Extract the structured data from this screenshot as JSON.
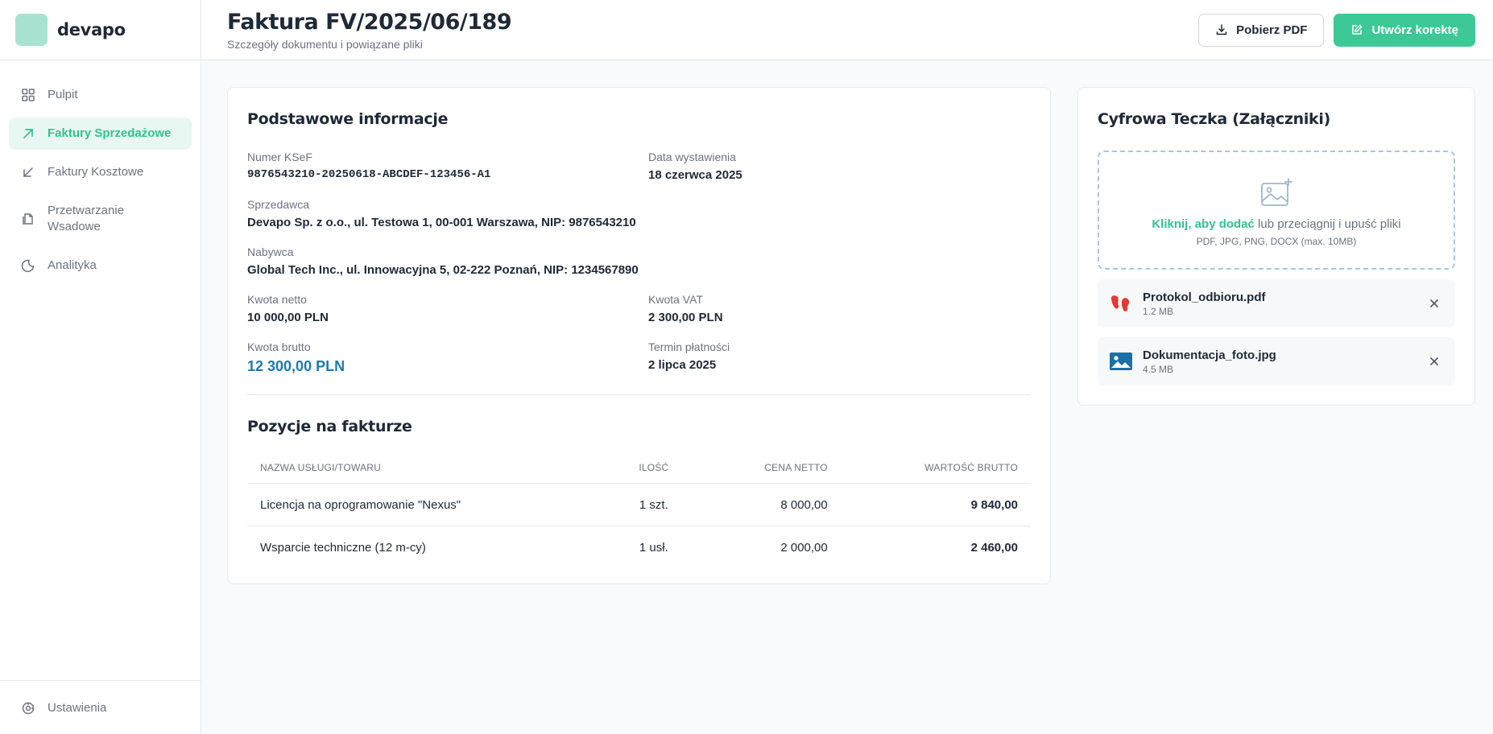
{
  "brand": {
    "name": "devapo"
  },
  "sidebar": {
    "items": [
      {
        "label": "Pulpit",
        "icon": "grid-icon"
      },
      {
        "label": "Faktury Sprzedażowe",
        "icon": "arrow-up-right-icon",
        "active": true
      },
      {
        "label": "Faktury Kosztowe",
        "icon": "arrow-down-left-icon"
      },
      {
        "label": "Przetwarzanie Wsadowe",
        "icon": "files-icon"
      },
      {
        "label": "Analityka",
        "icon": "chart-pie-icon"
      }
    ],
    "footer": {
      "label": "Ustawienia",
      "icon": "settings-icon"
    }
  },
  "header": {
    "title": "Faktura FV/2025/06/189",
    "subtitle": "Szczegóły dokumentu i powiązane pliki",
    "download_label": "Pobierz PDF",
    "correction_label": "Utwórz korektę"
  },
  "info": {
    "title": "Podstawowe informacje",
    "ksef_label": "Numer KSeF",
    "ksef_value": "9876543210-20250618-ABCDEF-123456-A1",
    "issue_date_label": "Data wystawienia",
    "issue_date_value": "18 czerwca 2025",
    "seller_label": "Sprzedawca",
    "seller_value": "Devapo Sp. z o.o., ul. Testowa 1, 00-001 Warszawa, NIP: 9876543210",
    "buyer_label": "Nabywca",
    "buyer_value": "Global Tech Inc., ul. Innowacyjna 5, 02-222 Poznań, NIP: 1234567890",
    "net_label": "Kwota netto",
    "net_value": "10 000,00 PLN",
    "vat_label": "Kwota VAT",
    "vat_value": "2 300,00 PLN",
    "gross_label": "Kwota brutto",
    "gross_value": "12 300,00 PLN",
    "due_label": "Termin płatności",
    "due_value": "2 lipca 2025"
  },
  "items": {
    "title": "Pozycje na fakturze",
    "columns": [
      "Nazwa usługi/towaru",
      "Ilość",
      "Cena netto",
      "Wartość brutto"
    ],
    "rows": [
      {
        "name": "Licencja na oprogramowanie \"Nexus\"",
        "qty": "1 szt.",
        "net": "8 000,00",
        "gross": "9 840,00"
      },
      {
        "name": "Wsparcie techniczne (12 m-cy)",
        "qty": "1 usł.",
        "net": "2 000,00",
        "gross": "2 460,00"
      }
    ]
  },
  "files": {
    "title": "Cyfrowa Teczka (Załączniki)",
    "drop_link": "Kliknij, aby dodać",
    "drop_text": " lub przeciągnij i upuść pliki",
    "drop_hint": "PDF, JPG, PNG, DOCX (max. 10MB)",
    "list": [
      {
        "name": "Protokol_odbioru.pdf",
        "size": "1.2 MB",
        "icon": "pdf-icon"
      },
      {
        "name": "Dokumentacja_foto.jpg",
        "size": "4.5 MB",
        "icon": "image-icon"
      }
    ]
  },
  "colors": {
    "accent": "#3cc995",
    "accent_text": "#34c28f",
    "gross_value": "#1a7ab5",
    "pdf_icon": "#e53935",
    "image_icon": "#1d6fa5"
  }
}
